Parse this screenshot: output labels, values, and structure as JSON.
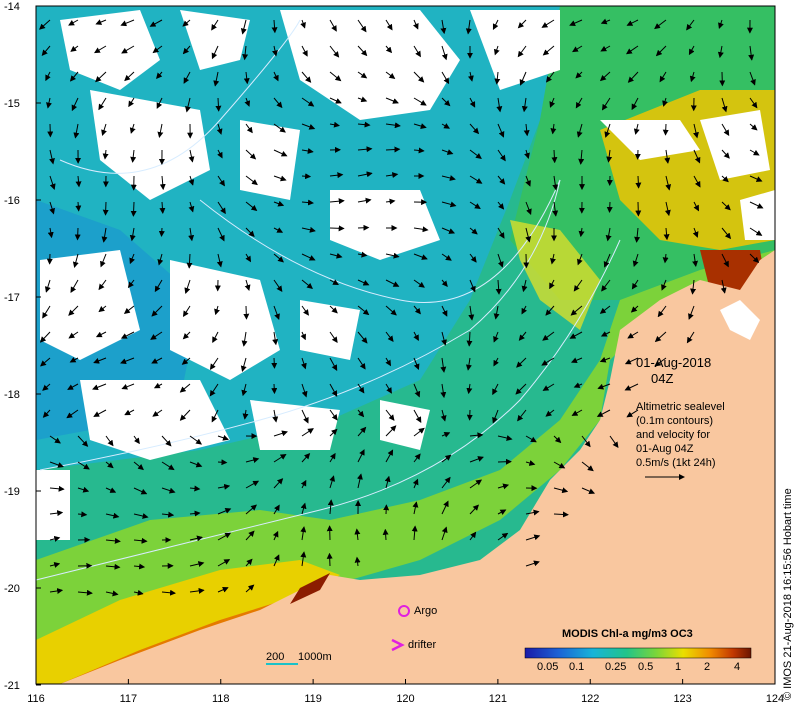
{
  "map": {
    "lon_ticks": [
      "116",
      "117",
      "118",
      "119",
      "120",
      "121",
      "122",
      "123",
      "124"
    ],
    "lat_ticks": [
      "-14",
      "-15",
      "-16",
      "-17",
      "-18",
      "-19",
      "-20",
      "-21"
    ],
    "date": "01-Aug-2018",
    "time": "04Z",
    "altimetry_note": [
      "Altimetric sealevel",
      "(0.1m contours)",
      "and velocity for",
      "01-Aug 04Z",
      "0.5m/s (1kt 24h)"
    ],
    "scale_bar": {
      "label_a": "200",
      "label_b": "1000m"
    },
    "argo_label": "Argo",
    "drifter_label": "drifter",
    "credit": "© IMOS 21-Aug-2018 16:15:56 Hobart time"
  },
  "colorbar": {
    "title": "MODIS Chl-a mg/m3 OC3",
    "ticks": [
      "0.05",
      "0.1",
      "0.25",
      "0.5",
      "1",
      "2",
      "4"
    ]
  },
  "colors": {
    "land": "#f9c79f",
    "cloud": "#ffffff",
    "low_chl": "#19b7c9",
    "mid_chl": "#2bbf6a",
    "high_chl": "#f2d200",
    "very_high": "#8b1d00",
    "argo": "#e020e0",
    "contour": "#cfe8ff"
  }
}
